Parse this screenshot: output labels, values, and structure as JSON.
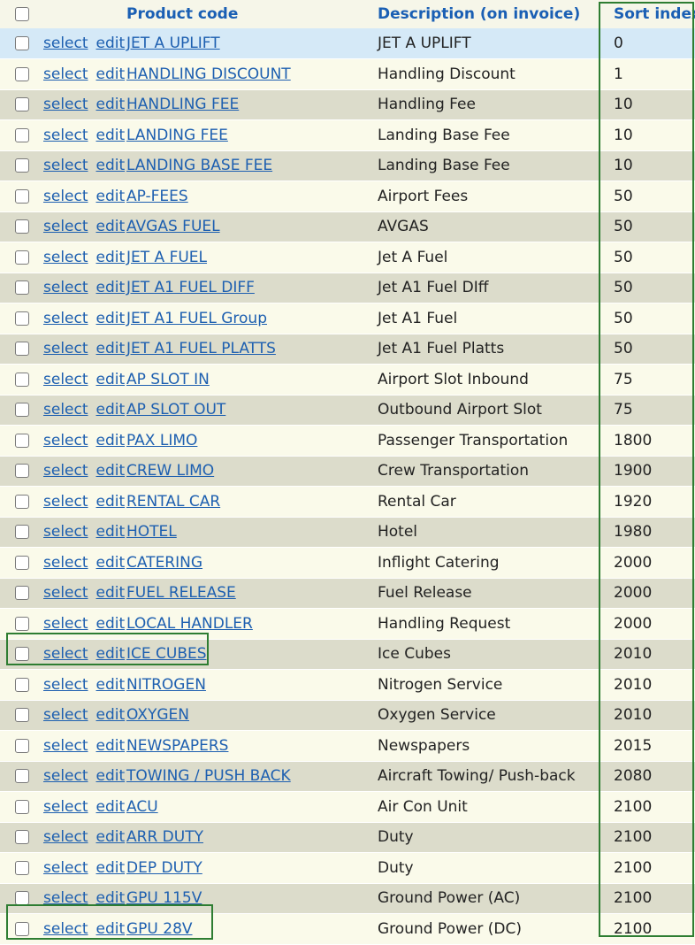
{
  "table": {
    "headers": {
      "product_code": "Product code",
      "description": "Description (on invoice)",
      "sort_index": "Sort index"
    },
    "actions": {
      "select": "select",
      "edit": "edit"
    },
    "rows": [
      {
        "code": "JET A UPLIFT",
        "description": "JET A UPLIFT",
        "sort": "0"
      },
      {
        "code": "HANDLING DISCOUNT",
        "description": "Handling Discount",
        "sort": "1"
      },
      {
        "code": "HANDLING FEE",
        "description": "Handling Fee",
        "sort": "10"
      },
      {
        "code": "LANDING FEE",
        "description": "Landing Base Fee",
        "sort": "10"
      },
      {
        "code": "LANDING BASE FEE",
        "description": "Landing Base Fee",
        "sort": "10"
      },
      {
        "code": "AP-FEES",
        "description": "Airport Fees",
        "sort": "50"
      },
      {
        "code": "AVGAS FUEL",
        "description": "AVGAS",
        "sort": "50"
      },
      {
        "code": "JET A FUEL",
        "description": "Jet A Fuel",
        "sort": "50"
      },
      {
        "code": "JET A1 FUEL DIFF",
        "description": "Jet A1 Fuel DIff",
        "sort": "50"
      },
      {
        "code": "JET A1 FUEL Group",
        "description": "Jet A1 Fuel",
        "sort": "50"
      },
      {
        "code": "JET A1 FUEL PLATTS",
        "description": "Jet A1 Fuel Platts",
        "sort": "50"
      },
      {
        "code": "AP SLOT IN",
        "description": "Airport Slot Inbound",
        "sort": "75"
      },
      {
        "code": "AP SLOT OUT",
        "description": "Outbound Airport Slot",
        "sort": "75"
      },
      {
        "code": "PAX LIMO",
        "description": "Passenger Transportation",
        "sort": "1800"
      },
      {
        "code": "CREW LIMO",
        "description": "Crew Transportation",
        "sort": "1900"
      },
      {
        "code": "RENTAL CAR",
        "description": "Rental Car",
        "sort": "1920"
      },
      {
        "code": "HOTEL",
        "description": "Hotel",
        "sort": "1980"
      },
      {
        "code": "CATERING",
        "description": "Inflight Catering",
        "sort": "2000"
      },
      {
        "code": "FUEL RELEASE",
        "description": "Fuel Release",
        "sort": "2000"
      },
      {
        "code": "LOCAL HANDLER",
        "description": "Handling Request",
        "sort": "2000"
      },
      {
        "code": "ICE CUBES",
        "description": "Ice Cubes",
        "sort": "2010"
      },
      {
        "code": "NITROGEN",
        "description": "Nitrogen Service",
        "sort": "2010"
      },
      {
        "code": "OXYGEN",
        "description": "Oxygen Service",
        "sort": "2010"
      },
      {
        "code": "NEWSPAPERS",
        "description": "Newspapers",
        "sort": "2015"
      },
      {
        "code": "TOWING / PUSH BACK",
        "description": "Aircraft Towing/ Push-back",
        "sort": "2080"
      },
      {
        "code": "ACU",
        "description": "Air Con Unit",
        "sort": "2100"
      },
      {
        "code": "ARR DUTY",
        "description": "Duty",
        "sort": "2100"
      },
      {
        "code": "DEP DUTY",
        "description": "Duty",
        "sort": "2100"
      },
      {
        "code": "GPU 115V",
        "description": "Ground Power (AC)",
        "sort": "2100"
      },
      {
        "code": "GPU 28V",
        "description": "Ground Power (DC)",
        "sort": "2100"
      }
    ]
  },
  "colors": {
    "link": "#1d5fb0",
    "header_text": "#1a5fb4",
    "row_odd": "#fafaea",
    "row_even": "#dcdccb",
    "row_selected": "#d5e9f7",
    "highlight_border": "#2e7d32"
  }
}
